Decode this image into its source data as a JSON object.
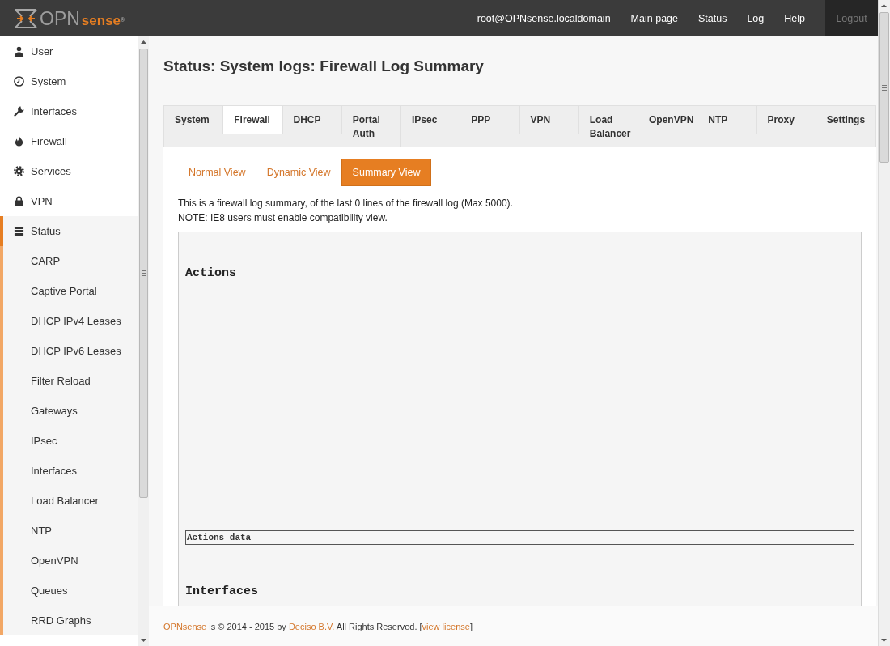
{
  "header": {
    "brand": {
      "prefix": "OPN",
      "suffix": "sense",
      "mark": "®"
    },
    "nav": [
      {
        "label": "root@OPNsense.localdomain",
        "kind": "link"
      },
      {
        "label": "Main page",
        "kind": "link"
      },
      {
        "label": "Status",
        "kind": "link"
      },
      {
        "label": "Log",
        "kind": "link"
      },
      {
        "label": "Help",
        "kind": "link"
      },
      {
        "label": "Logout",
        "kind": "logout"
      }
    ]
  },
  "sidebar": {
    "items": [
      {
        "label": "User",
        "expanded": false
      },
      {
        "label": "System",
        "expanded": false
      },
      {
        "label": "Interfaces",
        "expanded": false
      },
      {
        "label": "Firewall",
        "expanded": false
      },
      {
        "label": "Services",
        "expanded": false
      },
      {
        "label": "VPN",
        "expanded": false
      },
      {
        "label": "Status",
        "expanded": true,
        "children": [
          {
            "label": "CARP"
          },
          {
            "label": "Captive Portal"
          },
          {
            "label": "DHCP IPv4 Leases"
          },
          {
            "label": "DHCP IPv6 Leases"
          },
          {
            "label": "Filter Reload"
          },
          {
            "label": "Gateways"
          },
          {
            "label": "IPsec"
          },
          {
            "label": "Interfaces"
          },
          {
            "label": "Load Balancer"
          },
          {
            "label": "NTP"
          },
          {
            "label": "OpenVPN"
          },
          {
            "label": "Queues"
          },
          {
            "label": "RRD Graphs"
          }
        ]
      }
    ]
  },
  "page_title": "Status: System logs: Firewall Log Summary",
  "tabs": [
    {
      "label": "System",
      "selected": false
    },
    {
      "label": "Firewall",
      "selected": true
    },
    {
      "label": "DHCP",
      "selected": false
    },
    {
      "label": "Portal Auth",
      "selected": false
    },
    {
      "label": "IPsec",
      "selected": false
    },
    {
      "label": "PPP",
      "selected": false
    },
    {
      "label": "VPN",
      "selected": false
    },
    {
      "label": "Load Balancer",
      "selected": false
    },
    {
      "label": "OpenVPN",
      "selected": false
    },
    {
      "label": "NTP",
      "selected": false
    },
    {
      "label": "Proxy",
      "selected": false
    },
    {
      "label": "Settings",
      "selected": false
    }
  ],
  "view_tabs": [
    {
      "label": "Normal View",
      "selected": false
    },
    {
      "label": "Dynamic View",
      "selected": false
    },
    {
      "label": "Summary View",
      "selected": true
    }
  ],
  "intro": [
    "This is a firewall log summary, of the last 0 lines of the firewall log (Max 5000).",
    "NOTE: IE8 users must enable compatibility view."
  ],
  "sections": [
    {
      "heading": "Actions",
      "data_label": "Actions data"
    },
    {
      "heading": "Interfaces"
    }
  ],
  "footer": {
    "parts": [
      {
        "kind": "link",
        "text": "OPNsense"
      },
      {
        "kind": "text",
        "text": " is © 2014 - 2015 by "
      },
      {
        "kind": "link",
        "text": "Deciso B.V."
      },
      {
        "kind": "text",
        "text": " All Rights Reserved. ["
      },
      {
        "kind": "link",
        "text": "view license"
      },
      {
        "kind": "text",
        "text": "]"
      }
    ]
  }
}
